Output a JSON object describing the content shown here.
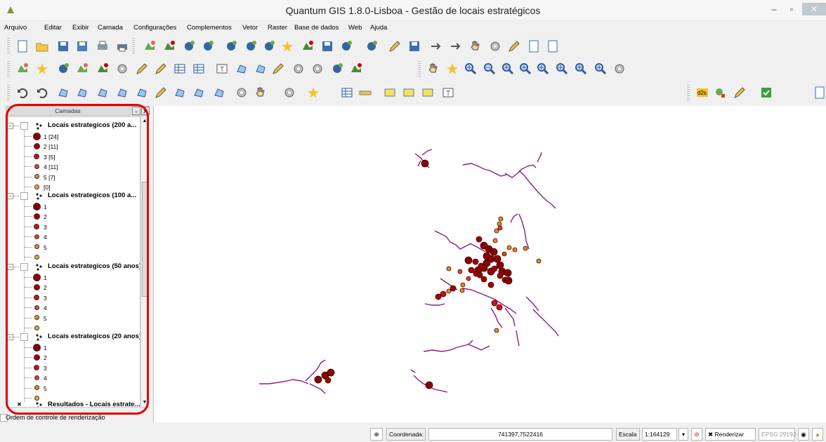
{
  "window": {
    "title": "Quantum GIS 1.8.0-Lisboa - Gestão de locais estratégicos"
  },
  "menu": [
    "Arquivo",
    "Editar",
    "Exibir",
    "Camada",
    "Configurações",
    "Complementos",
    "Vetor",
    "Raster",
    "Base de dados",
    "Web",
    "Ajuda"
  ],
  "layers_panel": {
    "title": "Camadas",
    "groups": [
      {
        "name": "Locais estrategicos (200 a...",
        "classes": [
          "1 [24]",
          "2 [11]",
          "3 [5]",
          "4 [11]",
          "5 [7]",
          " [0]"
        ]
      },
      {
        "name": "Locais estrategicos (100 a...",
        "classes": [
          "1",
          "2",
          "3",
          "4",
          "5",
          ""
        ]
      },
      {
        "name": "Locais estrategicos (50 anos)",
        "classes": [
          "1",
          "2",
          "3",
          "4",
          "5",
          ""
        ]
      },
      {
        "name": "Locais estrategicos (20 anos)",
        "classes": [
          "1",
          "2",
          "3",
          "4",
          "5",
          ""
        ]
      }
    ],
    "partial_layer": "Resultados - Locais estrate...",
    "class_colors": [
      "#8b0000",
      "#a00000",
      "#cc1010",
      "#d84a20",
      "#e08a2a",
      "#e8a840"
    ],
    "render_order_label": "Ordem de controle de renderização"
  },
  "statusbar": {
    "coord_label": "Coordenada:",
    "coord_value": "741397,7522416",
    "scale_label": "Escala",
    "scale_value": "1:164129",
    "render_label": "Renderizar",
    "epsg": "EPSG:29192"
  },
  "colors": {
    "river": "#8b1a8b",
    "highlight": "#e00000"
  }
}
